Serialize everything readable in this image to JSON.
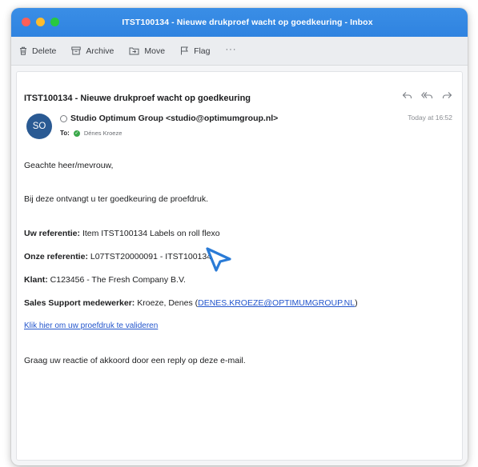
{
  "window": {
    "title": "ITST100134 - Nieuwe drukproef wacht op goedkeuring - Inbox"
  },
  "toolbar": {
    "delete_label": "Delete",
    "archive_label": "Archive",
    "move_label": "Move",
    "flag_label": "Flag",
    "more_label": "···"
  },
  "email": {
    "subject": "ITST100134 - Nieuwe drukproef wacht op goedkeuring",
    "avatar_initials": "SO",
    "sender": "Studio Optimum Group <studio@optimumgroup.nl>",
    "to_label": "To:",
    "to_name": "Dénes Kroeze",
    "date": "Today at 16:52",
    "greeting": "Geachte heer/mevrouw,",
    "intro": "Bij deze ontvangt u ter goedkeuring de proefdruk.",
    "ref_label": "Uw referentie:",
    "ref_value": "Item ITST100134 Labels on roll flexo",
    "our_ref_label": "Onze referentie:",
    "our_ref_value": "L07TST20000091 - ITST100134",
    "client_label": "Klant:",
    "client_value": "C123456 - The Fresh Company B.V.",
    "sales_label": "Sales Support medewerker:",
    "sales_name": "Kroeze, Denes (",
    "sales_email": "DENES.KROEZE@OPTIMUMGROUP.NL",
    "sales_close": ")",
    "validate_link": "Klik hier om uw proefdruk te valideren",
    "closing": "Graag uw reactie of akkoord door een reply op deze e-mail."
  },
  "colors": {
    "titlebar": "#2f83e0",
    "avatar": "#2a5a93",
    "link": "#2255cc",
    "cursor": "#2a7bd6"
  }
}
